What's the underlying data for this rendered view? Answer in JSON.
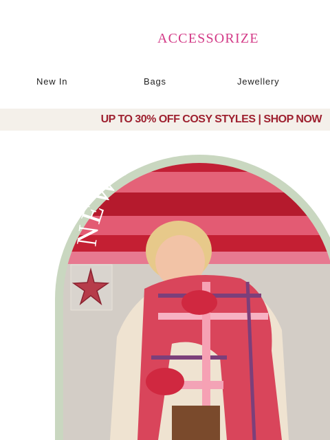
{
  "brand": {
    "logo_text": "ACCESSORIZE"
  },
  "nav": {
    "items": [
      {
        "label": "New In"
      },
      {
        "label": "Bags"
      },
      {
        "label": "Jewellery"
      }
    ]
  },
  "promo": {
    "text": "UP TO 30% OFF COSY STYLES | SHOP NOW"
  },
  "hero": {
    "arc_text": "NEW NEW NEW NEW",
    "colors": {
      "frame": "#c9d7c0",
      "stripe_red": "#c21f35",
      "stripe_pink": "#e46278",
      "wall": "#d3cdc6",
      "brand_pink": "#d33a87"
    }
  }
}
